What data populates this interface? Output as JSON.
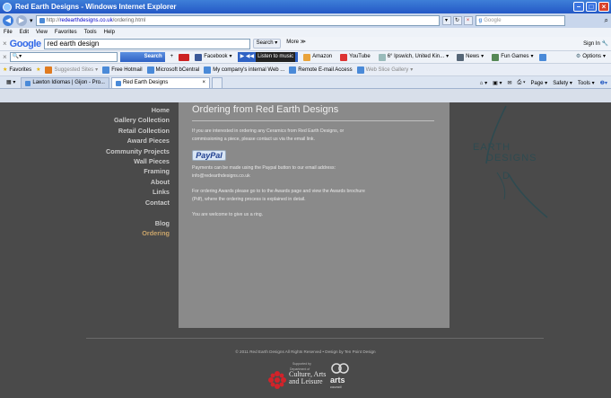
{
  "window": {
    "title": "Red Earth Designs - Windows Internet Explorer"
  },
  "address": {
    "url_prefix": "http://",
    "url_host": "redearthdesigns.co.uk",
    "url_path": "/ordering.html",
    "search_placeholder": "Google"
  },
  "menu": [
    "File",
    "Edit",
    "View",
    "Favorites",
    "Tools",
    "Help"
  ],
  "google_toolbar": {
    "logo": "Google",
    "query": "red earth design",
    "search_label": "Search",
    "more_label": "More ≫",
    "signin": "Sign In"
  },
  "toolbar2": {
    "search_label": "Search",
    "facebook": "Facebook",
    "listen": "Listen to music",
    "amazon": "Amazon",
    "youtube": "YouTube",
    "weather": "6° Ipswich, United Kin...",
    "news": "News",
    "fun_games": "Fun Games",
    "options": "Options"
  },
  "favorites_bar": {
    "favorites": "Favorites",
    "suggested": "Suggested Sites",
    "hotmail": "Free Hotmail",
    "bcentral": "Microsoft bCentral",
    "company": "My company's internal Web ...",
    "remote": "Remote E-mail Access",
    "webslice": "Web Slice Gallery"
  },
  "tabs": [
    {
      "label": "Lawton Idiomas | Gijon - Pro..."
    },
    {
      "label": "Red Earth Designs"
    }
  ],
  "command_bar": {
    "page": "Page",
    "safety": "Safety",
    "tools": "Tools"
  },
  "site": {
    "nav": [
      "Home",
      "Gallery Collection",
      "Retail Collection",
      "Award Pieces",
      "Community Projects",
      "Wall Pieces",
      "Framing",
      "About",
      "Links",
      "Contact"
    ],
    "nav_lower": [
      "Blog",
      "Ordering"
    ],
    "heading": "Ordering from Red Earth Designs",
    "para1": [
      "If you are interested in ordering any Ceramics from Red Earth Designs, or",
      "commissioning a piece, please contact us via the email link."
    ],
    "paypal": "PayPal",
    "para2": [
      "Payments can be made using the Paypal button to our email address:",
      "info@redearthdesigns.co.uk"
    ],
    "para3": [
      "For ordering Awards please go to to the Awards page and view the Awards brochure",
      "(Pdf), where the ordering process is explained in detail."
    ],
    "para4": "You are welcome to give us a ring.",
    "logo": {
      "l1": "EARTH",
      "l2": "DESIGNS",
      "l3": "D"
    },
    "footer": {
      "copyright": "© 2011 Red Earth Designs All Rights Reserved  •  Design by Ten Point Design",
      "supported_by": "Supported by",
      "dept": "Department of",
      "culture1": "Culture, Arts",
      "culture2": "and Leisure",
      "arts": "arts",
      "council": "council"
    }
  },
  "colors": {
    "accent_nav_current": "#c9a46a",
    "content_bg": "#8a8a8a",
    "page_bg": "#4a4a4a"
  }
}
